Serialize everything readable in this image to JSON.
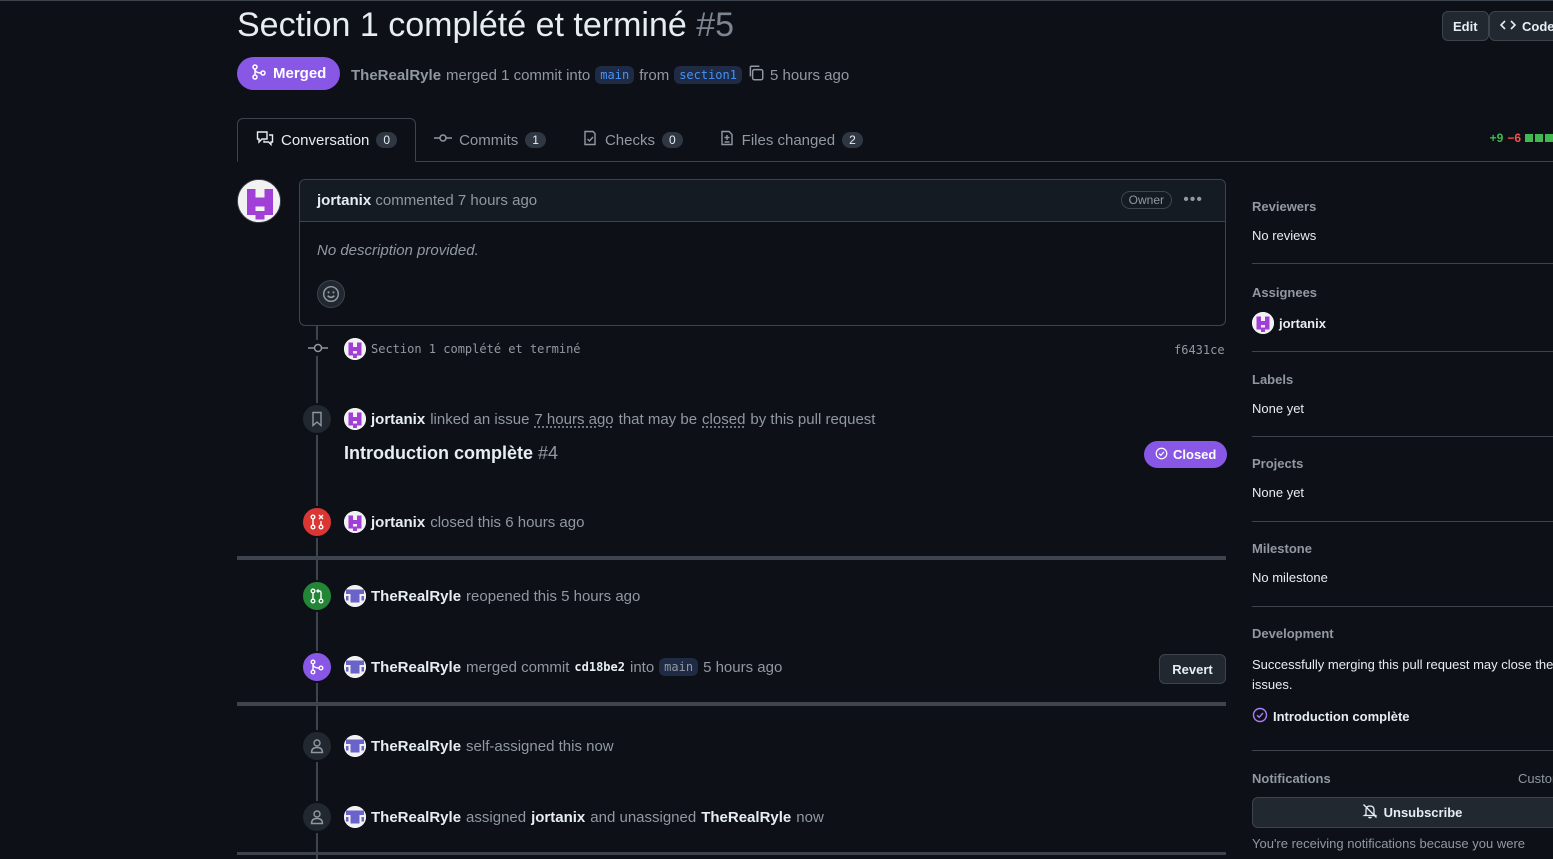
{
  "header": {
    "title": "Section 1 complété et terminé",
    "number": "#5",
    "edit_label": "Edit",
    "code_label": "Code",
    "state_label": "Merged",
    "author": "TheRealRyle",
    "merge_text": "merged 1 commit into",
    "base_branch": "main",
    "from_text": "from",
    "head_branch": "section1",
    "time": "5 hours ago"
  },
  "tabs": [
    {
      "label": "Conversation",
      "count": "0",
      "icon": "comment-discussion-icon"
    },
    {
      "label": "Commits",
      "count": "1",
      "icon": "git-commit-icon"
    },
    {
      "label": "Checks",
      "count": "0",
      "icon": "checklist-icon"
    },
    {
      "label": "Files changed",
      "count": "2",
      "icon": "file-diff-icon"
    }
  ],
  "diffstat": {
    "additions": "+9",
    "deletions": "−6"
  },
  "comment": {
    "author": "jortanix",
    "action": "commented 7 hours ago",
    "badge": "Owner",
    "body": "No description provided."
  },
  "timeline": {
    "commit": {
      "message": "Section 1 complété et terminé",
      "sha": "f6431ce"
    },
    "linked": {
      "user": "jortanix",
      "pre": "linked an issue",
      "time": "7 hours ago",
      "mid": "that may be",
      "closed_word": "closed",
      "post": "by this pull request",
      "issue_title": "Introduction complète",
      "issue_number": "#4",
      "issue_state": "Closed"
    },
    "closed": {
      "user": "jortanix",
      "text": "closed this 6 hours ago"
    },
    "reopened": {
      "user": "TheRealRyle",
      "text": "reopened this 5 hours ago"
    },
    "merged": {
      "user": "TheRealRyle",
      "pre": "merged commit",
      "sha": "cd18be2",
      "into": "into",
      "branch": "main",
      "time": "5 hours ago",
      "revert_label": "Revert"
    },
    "self_assigned": {
      "user": "TheRealRyle",
      "text": "self-assigned this now"
    },
    "assigned": {
      "user": "TheRealRyle",
      "pre": "assigned",
      "assignee": "jortanix",
      "mid": "and unassigned",
      "unassignee": "TheRealRyle",
      "post": "now"
    }
  },
  "sidebar": {
    "reviewers": {
      "label": "Reviewers",
      "value": "No reviews"
    },
    "assignees": {
      "label": "Assignees",
      "value": "jortanix"
    },
    "labels": {
      "label": "Labels",
      "value": "None yet"
    },
    "projects": {
      "label": "Projects",
      "value": "None yet"
    },
    "milestone": {
      "label": "Milestone",
      "value": "No milestone"
    },
    "development": {
      "label": "Development",
      "text": "Successfully merging this pull request may close these issues.",
      "issue": "Introduction complète"
    },
    "notifications": {
      "label": "Notifications",
      "customize": "Customize",
      "button": "Unsubscribe",
      "reason": "You're receiving notifications because you were"
    }
  },
  "colors": {
    "purple": "#8957e5",
    "red": "#da3633",
    "green": "#238636",
    "blue": "#4493f8",
    "bg": "#0d1117",
    "border": "#3d444d"
  }
}
